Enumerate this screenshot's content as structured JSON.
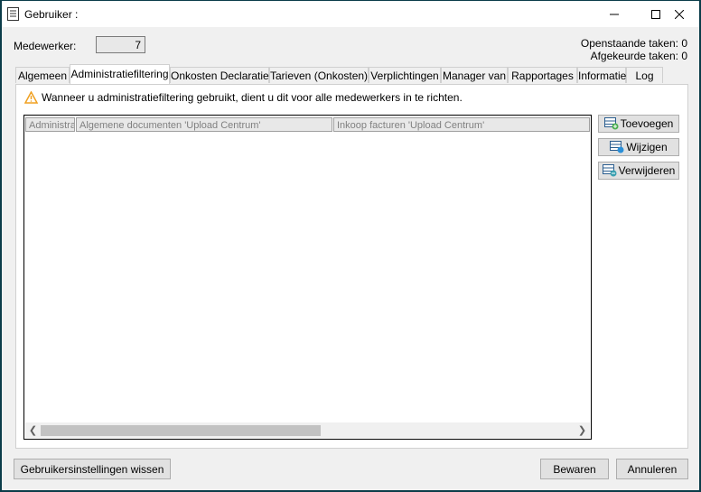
{
  "window": {
    "title": "Gebruiker :"
  },
  "header": {
    "medewerker_label": "Medewerker:",
    "medewerker_value": "7",
    "openstaande_taken": "Openstaande taken: 0",
    "afgekeurde_taken": "Afgekeurde taken: 0"
  },
  "tabs": [
    {
      "label": "Algemeen"
    },
    {
      "label": "Administratiefiltering"
    },
    {
      "label": "Onkosten Declaratie"
    },
    {
      "label": "Tarieven (Onkosten)"
    },
    {
      "label": "Verplichtingen"
    },
    {
      "label": "Manager van"
    },
    {
      "label": "Rapportages"
    },
    {
      "label": "Informatie"
    },
    {
      "label": "Log"
    }
  ],
  "active_tab": "Administratiefiltering",
  "panel": {
    "warning": "Wanneer u administratiefiltering gebruikt, dient u dit voor alle medewerkers in te richten.",
    "columns": [
      "Administra",
      "Algemene documenten 'Upload Centrum'",
      "Inkoop facturen 'Upload Centrum'"
    ],
    "rows": []
  },
  "side_buttons": {
    "add": "Toevoegen",
    "edit": "Wijzigen",
    "delete": "Verwijderen"
  },
  "footer": {
    "reset": "Gebruikersinstellingen wissen",
    "save": "Bewaren",
    "cancel": "Annuleren"
  },
  "colors": {
    "accent": "#0b3c49",
    "warning": "#f0a020"
  }
}
